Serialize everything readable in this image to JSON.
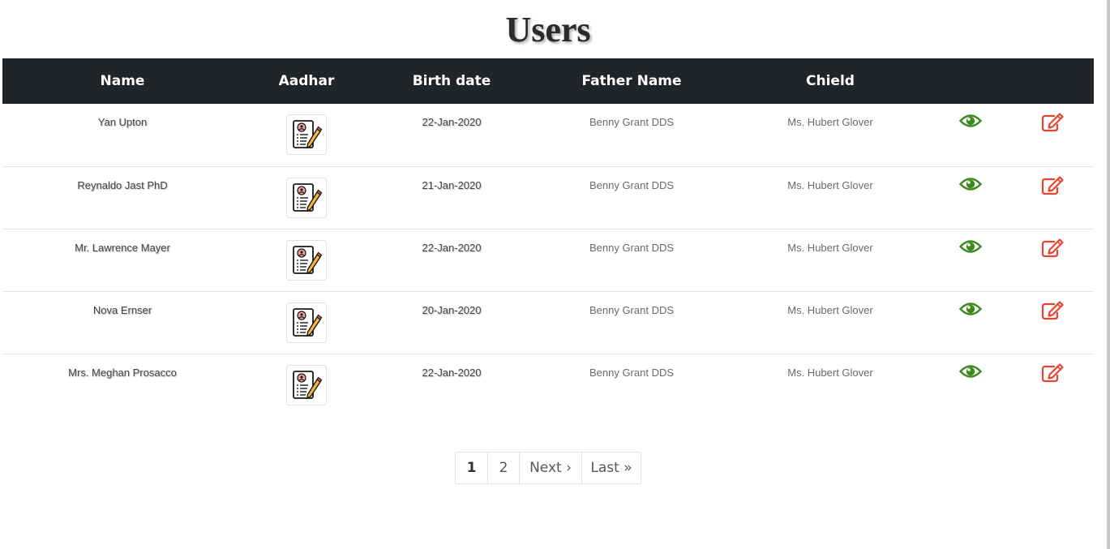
{
  "page": {
    "title": "Users"
  },
  "table": {
    "columns": [
      "Name",
      "Aadhar",
      "Birth date",
      "Father Name",
      "Chield",
      "",
      ""
    ],
    "rows": [
      {
        "name": "Yan Upton",
        "birth_date": "22-Jan-2020",
        "father_name": "Benny Grant DDS",
        "child": "Ms. Hubert Glover"
      },
      {
        "name": "Reynaldo Jast PhD",
        "birth_date": "21-Jan-2020",
        "father_name": "Benny Grant DDS",
        "child": "Ms. Hubert Glover"
      },
      {
        "name": "Mr. Lawrence Mayer",
        "birth_date": "22-Jan-2020",
        "father_name": "Benny Grant DDS",
        "child": "Ms. Hubert Glover"
      },
      {
        "name": "Nova Ernser",
        "birth_date": "20-Jan-2020",
        "father_name": "Benny Grant DDS",
        "child": "Ms. Hubert Glover"
      },
      {
        "name": "Mrs. Meghan Prosacco",
        "birth_date": "22-Jan-2020",
        "father_name": "Benny Grant DDS",
        "child": "Ms. Hubert Glover"
      }
    ],
    "row_icons": {
      "aadhar": "document-edit-icon",
      "view": "eye-icon",
      "edit": "edit-icon"
    }
  },
  "pagination": {
    "items": [
      {
        "label": "1",
        "active": true
      },
      {
        "label": "2",
        "active": false
      },
      {
        "label": "Next ›",
        "active": false
      },
      {
        "label": "Last »",
        "active": false
      }
    ]
  },
  "colors": {
    "header_bg": "#212529",
    "view_icon": "#3c8a1e",
    "edit_icon": "#e8442e"
  }
}
